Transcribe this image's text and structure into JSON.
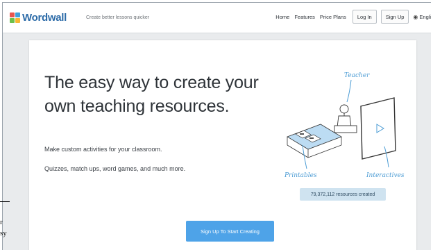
{
  "header": {
    "logo_text": "Wordwall",
    "logo_colors": [
      "#e8554e",
      "#41a0d9",
      "#6cc04a",
      "#f7b733"
    ],
    "tagline": "Create better lessons quicker",
    "nav": {
      "home": "Home",
      "features": "Features",
      "price_plans": "Price Plans"
    },
    "login_label": "Log In",
    "signup_label": "Sign Up",
    "language": "English",
    "language_icon": "globe-icon"
  },
  "hero": {
    "headline_line1": "The easy way to create your",
    "headline_line2": "own teaching resources.",
    "sub1": "Make custom activities for your classroom.",
    "sub2": "Quizzes, match ups, word games, and much more."
  },
  "illustration": {
    "teacher_label": "Teacher",
    "printables_label": "Printables",
    "interactives_label": "Interactives"
  },
  "stats": {
    "resources_created": "79,372,112 resources created"
  },
  "cta": {
    "label": "Sign Up To Start Creating"
  },
  "edge_fragment": {
    "line1": "r",
    "line2": "sy"
  },
  "colors": {
    "accent": "#4ea3e8",
    "brand": "#2c6ba8",
    "badge_bg": "#cfe3f0",
    "sketch_blue": "#4a9bd4"
  }
}
